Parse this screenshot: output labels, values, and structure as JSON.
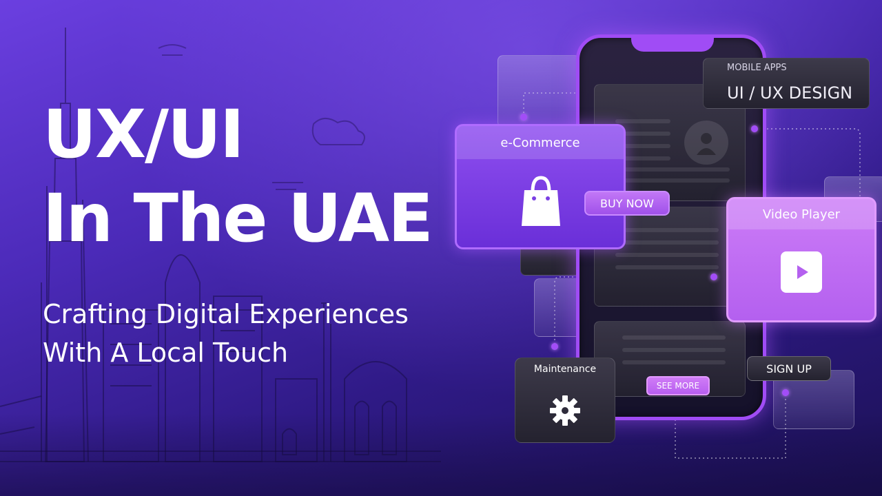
{
  "headline": {
    "line1": "UX/UI",
    "line2": "In The UAE"
  },
  "subtitle": "Crafting Digital Experiences With A Local Touch",
  "cards": {
    "mobile_apps_label": "MOBILE APPS",
    "uiux_title": "UI / UX DESIGN",
    "ecommerce_title": "e-Commerce",
    "buy_now_label": "BUY NOW",
    "video_player_title": "Video Player",
    "maintenance_title": "Maintenance",
    "see_more_label": "SEE  MORE",
    "sign_up_label": "SIGN UP"
  },
  "icons": [
    "shopping-bag-icon",
    "play-icon",
    "gear-icon",
    "user-avatar-icon"
  ],
  "colors": {
    "accent": "#a04cf5",
    "background_top": "#6b3fe0",
    "background_bottom": "#1b1154"
  }
}
